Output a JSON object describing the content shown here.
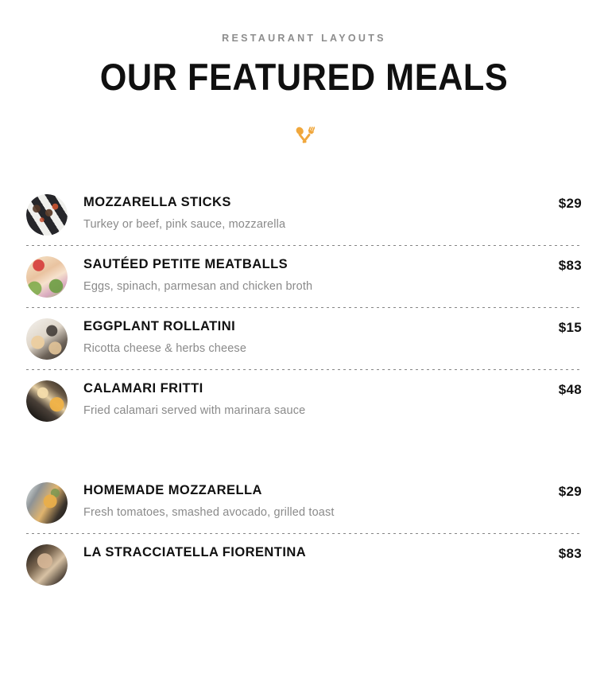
{
  "header": {
    "eyebrow": "RESTAURANT LAYOUTS",
    "title": "OUR FEATURED MEALS",
    "divider_icon": "fork-and-spoon-icon",
    "accent_color": "#f0a73c",
    "eyebrow_color": "#8d8d8d",
    "title_color": "#101010"
  },
  "menu": {
    "groups": [
      {
        "items": [
          {
            "name": "MOZZARELLA STICKS",
            "description": "Turkey or beef, pink sauce, mozzarella",
            "price": "$29",
            "image": "mozzarella-sticks-photo"
          },
          {
            "name": "SAUTÉED PETITE MEATBALLS",
            "description": "Eggs, spinach, parmesan and chicken broth",
            "price": "$83",
            "image": "sauteed-petite-meatballs-photo"
          },
          {
            "name": "EGGPLANT ROLLATINI",
            "description": "Ricotta cheese & herbs cheese",
            "price": "$15",
            "image": "eggplant-rollatini-photo"
          },
          {
            "name": "CALAMARI FRITTI",
            "description": "Fried calamari served with marinara sauce",
            "price": "$48",
            "image": "calamari-fritti-photo"
          }
        ]
      },
      {
        "items": [
          {
            "name": "HOMEMADE MOZZARELLA",
            "description": "Fresh tomatoes, smashed avocado, grilled toast",
            "price": "$29",
            "image": "homemade-mozzarella-photo"
          },
          {
            "name": "LA STRACCIATELLA FIORENTINA",
            "description": "",
            "price": "$83",
            "image": "la-stracciatella-fiorentina-photo"
          }
        ]
      }
    ]
  }
}
